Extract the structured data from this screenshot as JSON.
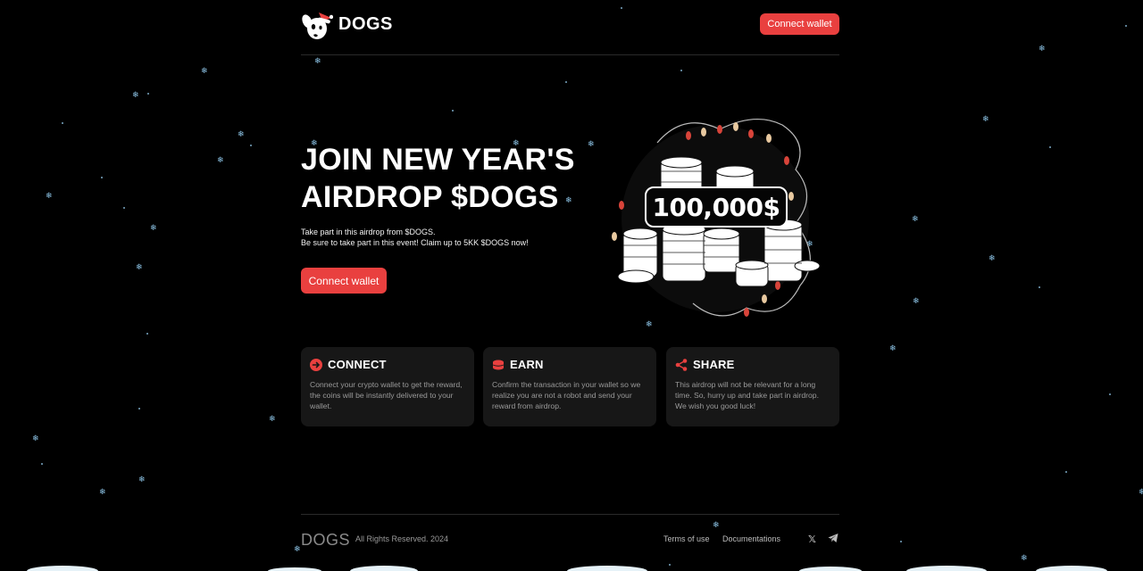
{
  "header": {
    "brand": "DOGS",
    "connect_label": "Connect wallet"
  },
  "hero": {
    "title_line1": "JOIN NEW YEAR'S",
    "title_line2": "AIRDROP $DOGS",
    "desc_line1": "Take part in this airdrop from $DOGS.",
    "desc_line2": "Be sure to take part in this event! Claim up to 5KK $DOGS now!",
    "connect_label": "Connect wallet",
    "amount": "100,000$"
  },
  "cards": [
    {
      "title": "CONNECT",
      "icon": "arrow-circle-icon",
      "text": "Connect your crypto wallet to get the reward, the coins will be instantly delivered to your wallet."
    },
    {
      "title": "EARN",
      "icon": "coins-icon",
      "text": "Confirm the transaction in your wallet so we realize you are not a robot and send your reward from airdrop."
    },
    {
      "title": "SHARE",
      "icon": "share-icon",
      "text": "This airdrop will not be relevant for a long time. So, hurry up and take part in airdrop. We wish you good luck!"
    }
  ],
  "footer": {
    "logo": "DOGS",
    "rights": "All Rights Reserved. 2024",
    "terms": "Terms of use",
    "docs": "Documentations",
    "x_icon": "x-icon",
    "telegram_icon": "telegram-icon"
  },
  "colors": {
    "accent": "#e9403f",
    "background": "#000000",
    "card": "#171717",
    "snow": "#8fc7ea"
  }
}
